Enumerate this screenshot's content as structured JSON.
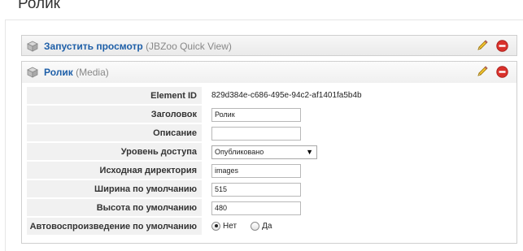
{
  "page": {
    "title": "Ролик"
  },
  "panels": [
    {
      "name": "Запустить просмотр",
      "type": "(JBZoo Quick View)"
    },
    {
      "name": "Ролик",
      "type": "(Media)"
    }
  ],
  "fields": {
    "element_id": {
      "label": "Element ID",
      "value": "829d384e-c686-495e-94c2-af1401fa5b4b"
    },
    "title": {
      "label": "Заголовок",
      "value": "Ролик"
    },
    "description": {
      "label": "Описание",
      "value": ""
    },
    "access": {
      "label": "Уровень доступа",
      "value": "Опубликовано"
    },
    "directory": {
      "label": "Исходная директория",
      "value": "images"
    },
    "width": {
      "label": "Ширина по умолчанию",
      "value": "515"
    },
    "height": {
      "label": "Высота по умолчанию",
      "value": "480"
    },
    "autoplay": {
      "label": "Автовоспроизведение по умолчанию",
      "options": [
        "Нет",
        "Да"
      ],
      "selected": "Нет"
    }
  },
  "icons": {
    "panel": "cube-icon",
    "edit": "pencil-icon",
    "delete": "minus-circle-icon"
  },
  "colors": {
    "link": "#1e5fa8",
    "delete": "#d9312b",
    "label_bg": "#f1f1f1"
  }
}
